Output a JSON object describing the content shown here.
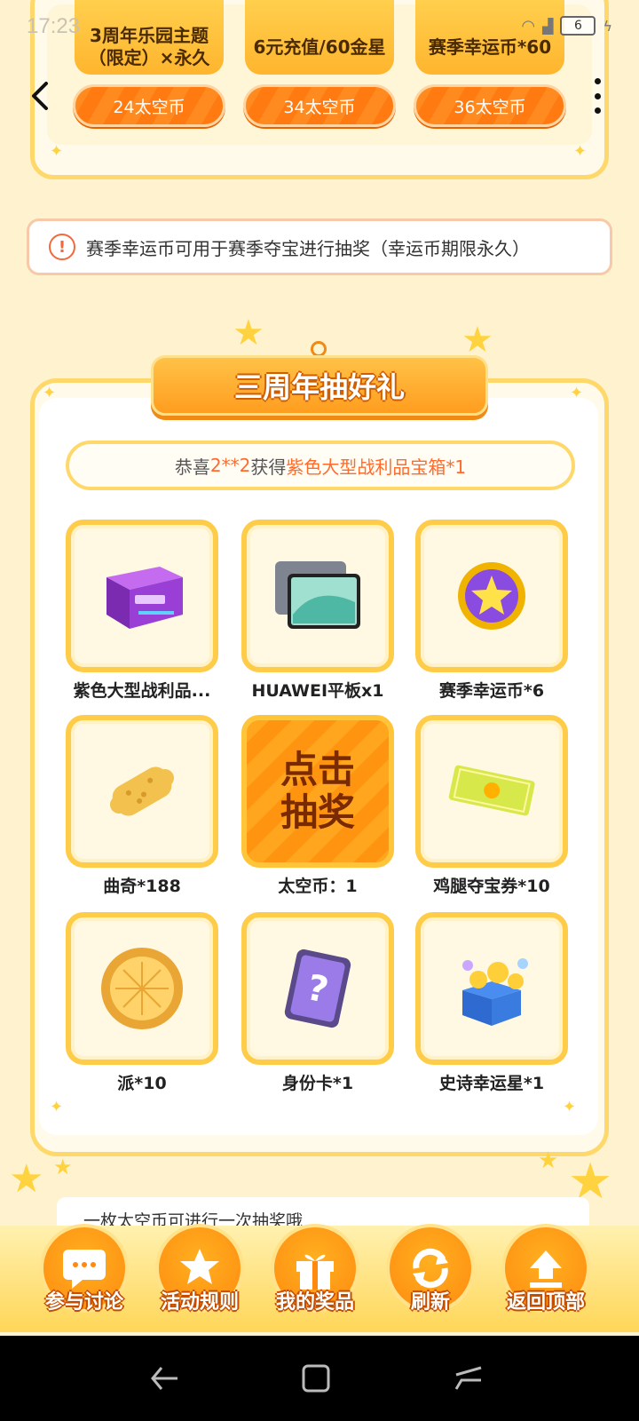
{
  "status_bar": {
    "time": "17:23",
    "battery": "6"
  },
  "exchange": {
    "items": [
      {
        "name": "3周年乐园主题（限定）×永久",
        "price": "24太空币"
      },
      {
        "name": "6元充值/60金星",
        "price": "34太空币"
      },
      {
        "name": "赛季幸运币*60",
        "price": "36太空币"
      }
    ]
  },
  "notice": {
    "text": "赛季幸运币可用于赛季夺宝进行抽奖（幸运币期限永久）"
  },
  "lottery": {
    "title": "三周年抽好礼",
    "congrats": {
      "prefix": "恭喜",
      "user": "2**2",
      "middle": "获得",
      "prize": "紫色大型战利品宝箱*1"
    },
    "prizes": [
      {
        "label": "紫色大型战利品...",
        "icon": "purple-chest-icon"
      },
      {
        "label": "HUAWEI平板x1",
        "icon": "tablet-icon"
      },
      {
        "label": "赛季幸运币*6",
        "icon": "lucky-coin-icon"
      },
      {
        "label": "曲奇*188",
        "icon": "cookie-icon"
      },
      {
        "label": "太空币：1",
        "icon": "draw-button"
      },
      {
        "label": "鸡腿夺宝券*10",
        "icon": "ticket-icon"
      },
      {
        "label": "派*10",
        "icon": "pie-icon"
      },
      {
        "label": "身份卡*1",
        "icon": "identity-card-icon"
      },
      {
        "label": "史诗幸运星*1",
        "icon": "epic-star-box-icon"
      }
    ],
    "draw_button": {
      "line1": "点击",
      "line2": "抽奖"
    }
  },
  "hint": {
    "text": "一枚太空币可进行一次抽奖哦"
  },
  "footer": {
    "buttons": [
      {
        "label": "参与讨论",
        "icon": "chat-icon"
      },
      {
        "label": "活动规则",
        "icon": "rules-icon"
      },
      {
        "label": "我的奖品",
        "icon": "gift-icon"
      },
      {
        "label": "刷新",
        "icon": "refresh-icon"
      },
      {
        "label": "返回顶部",
        "icon": "back-to-top-icon"
      }
    ]
  },
  "colors": {
    "accent": "#ff8a1f",
    "frame": "#ffcc4a",
    "background": "#fff3cf"
  }
}
